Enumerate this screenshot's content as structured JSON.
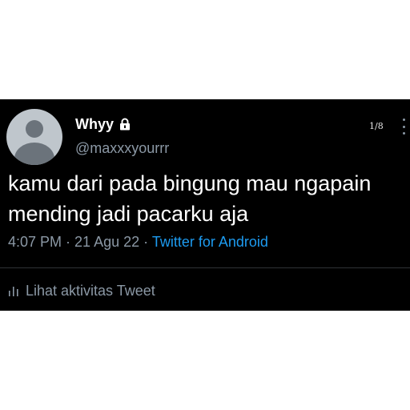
{
  "tweet": {
    "display_name": "Whyy",
    "handle": "@maxxxyourrr",
    "page_indicator": "1/8",
    "text": "kamu dari pada bingung mau ngapain\nmending jadi pacarku aja",
    "time": "4:07 PM",
    "date": "21 Agu 22",
    "separator": " · ",
    "source": "Twitter for Android",
    "activity_label": "Lihat aktivitas Tweet",
    "icons": {
      "lock": "lock-icon",
      "more": "more-icon",
      "activity": "bar-chart-icon",
      "avatar": "default-avatar"
    }
  },
  "colors": {
    "background": "#000000",
    "text": "#ffffff",
    "secondary": "#8b98a5",
    "link": "#1d9bf0"
  }
}
